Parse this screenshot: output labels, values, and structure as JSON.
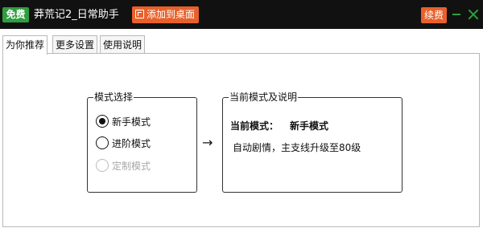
{
  "titlebar": {
    "free_badge": "免费",
    "app_title": "莽荒记2_日常助手",
    "add_to_desktop": "添加到桌面",
    "renew_button": "续费"
  },
  "tabs": [
    {
      "label": "为你推荐",
      "active": true
    },
    {
      "label": "更多设置",
      "active": false
    },
    {
      "label": "使用说明",
      "active": false
    }
  ],
  "mode_select": {
    "title": "模式选择",
    "options": [
      {
        "label": "新手模式",
        "checked": true,
        "disabled": false
      },
      {
        "label": "进阶模式",
        "checked": false,
        "disabled": false
      },
      {
        "label": "定制模式",
        "checked": false,
        "disabled": true
      }
    ]
  },
  "arrow": "→",
  "current_mode": {
    "title": "当前模式及说明",
    "label": "当前模式：",
    "value": "新手模式",
    "description": "自动剧情，主支线升级至80级"
  },
  "colors": {
    "titlebar_bg": "#111111",
    "free_badge": "#2f9e3f",
    "accent_orange": "#e8612a",
    "window_controls": "#2f9e3f"
  }
}
